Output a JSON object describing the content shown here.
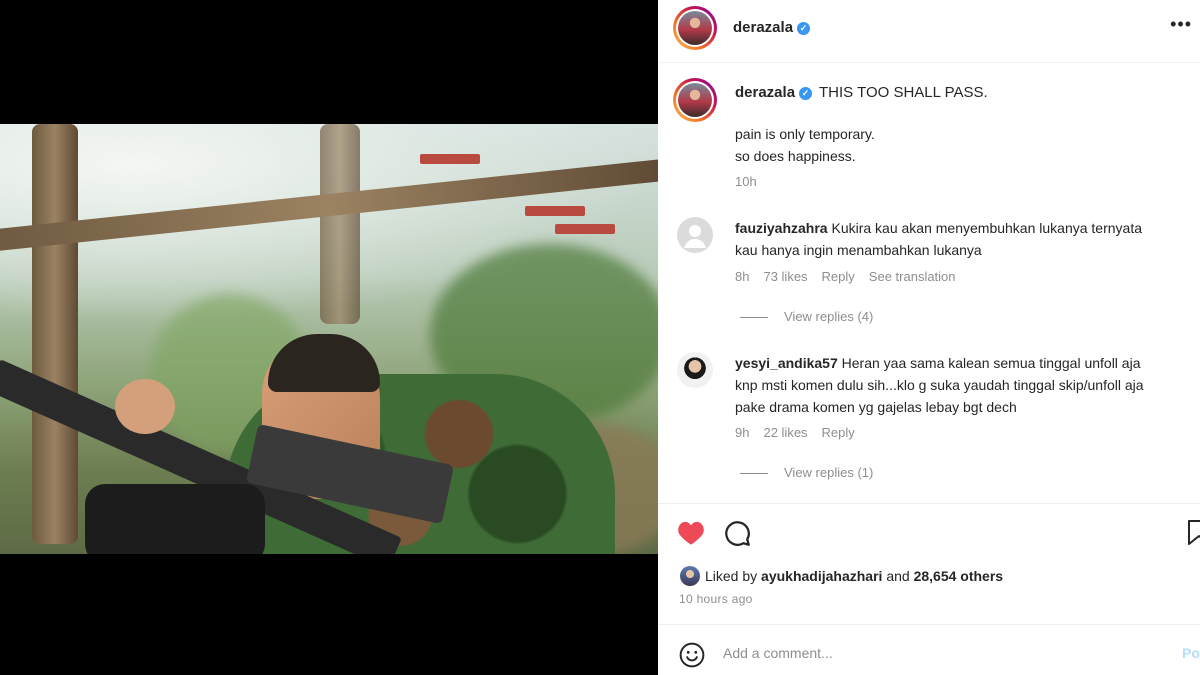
{
  "header": {
    "username": "derazala",
    "verified": true,
    "more_icon": "more-horizontal-icon"
  },
  "caption": {
    "username": "derazala",
    "title": "THIS TOO SHALL PASS.",
    "line1": "pain is only temporary.",
    "line2": "so does happiness.",
    "time": "10h"
  },
  "comments": [
    {
      "username": "fauziyahzahra",
      "text": "Kukira kau akan menyembuhkan lukanya ternyata kau hanya ingin menambahkan lukanya",
      "time": "8h",
      "likes": "73 likes",
      "reply": "Reply",
      "translate": "See translation",
      "view_replies": "View replies (4)"
    },
    {
      "username": "yesyi_andika57",
      "text": "Heran yaa sama kalean semua tinggal unfoll aja knp msti komen dulu sih...klo g suka yaudah tinggal skip/unfoll aja pake drama komen yg gajelas lebay bgt dech",
      "time": "9h",
      "likes": "22 likes",
      "reply": "Reply",
      "view_replies": "View replies (1)"
    }
  ],
  "actions": {
    "like_icon": "heart-filled-icon",
    "comment_icon": "comment-icon",
    "save_icon": "bookmark-icon",
    "like_color": "#ed4956"
  },
  "likes": {
    "prefix": "Liked by",
    "user": "ayukhadijahazhari",
    "and": "and",
    "count": "28,654 others"
  },
  "post_time": "10 hours ago",
  "add_comment": {
    "emoji_icon": "emoji-icon",
    "placeholder": "Add a comment...",
    "post": "Post"
  }
}
